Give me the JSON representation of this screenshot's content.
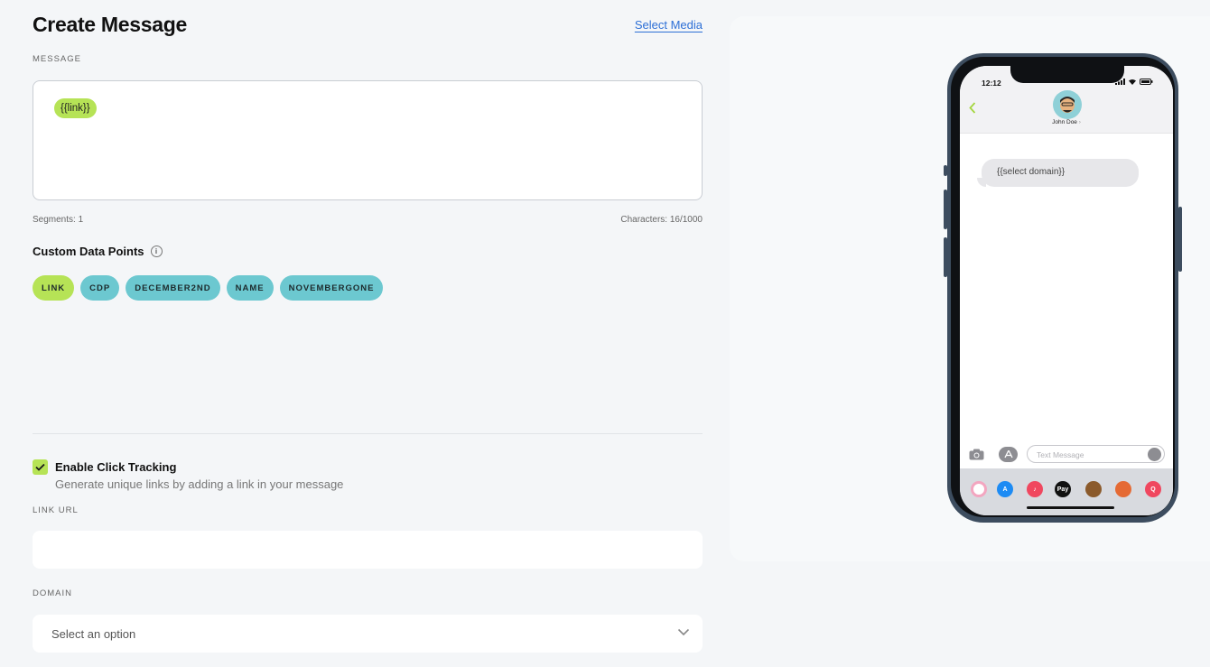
{
  "header": {
    "title": "Create Message",
    "select_media": "Select Media"
  },
  "message": {
    "label": "MESSAGE",
    "chip": "{{link}}",
    "segments": "Segments: 1",
    "characters": "Characters: 16/1000"
  },
  "custom_data_points": {
    "title": "Custom Data Points",
    "chips": [
      {
        "label": "LINK",
        "active": true
      },
      {
        "label": "CDP",
        "active": false
      },
      {
        "label": "DECEMBER2ND",
        "active": false
      },
      {
        "label": "NAME",
        "active": false
      },
      {
        "label": "NOVEMBERGONE",
        "active": false
      }
    ]
  },
  "click_tracking": {
    "checked": true,
    "title": "Enable Click Tracking",
    "description": "Generate unique links by adding a link in your message"
  },
  "link_url": {
    "label": "LINK URL",
    "value": ""
  },
  "domain": {
    "label": "DOMAIN",
    "placeholder": "Select an option"
  },
  "preview": {
    "time": "12:12",
    "contact_name": "John Doe",
    "bubble_text": "{{select domain}}",
    "input_placeholder": "Text Message"
  },
  "colors": {
    "accent_green": "#b6e356",
    "chip_teal": "#6cc8d0",
    "link_blue": "#2d6fd6"
  }
}
